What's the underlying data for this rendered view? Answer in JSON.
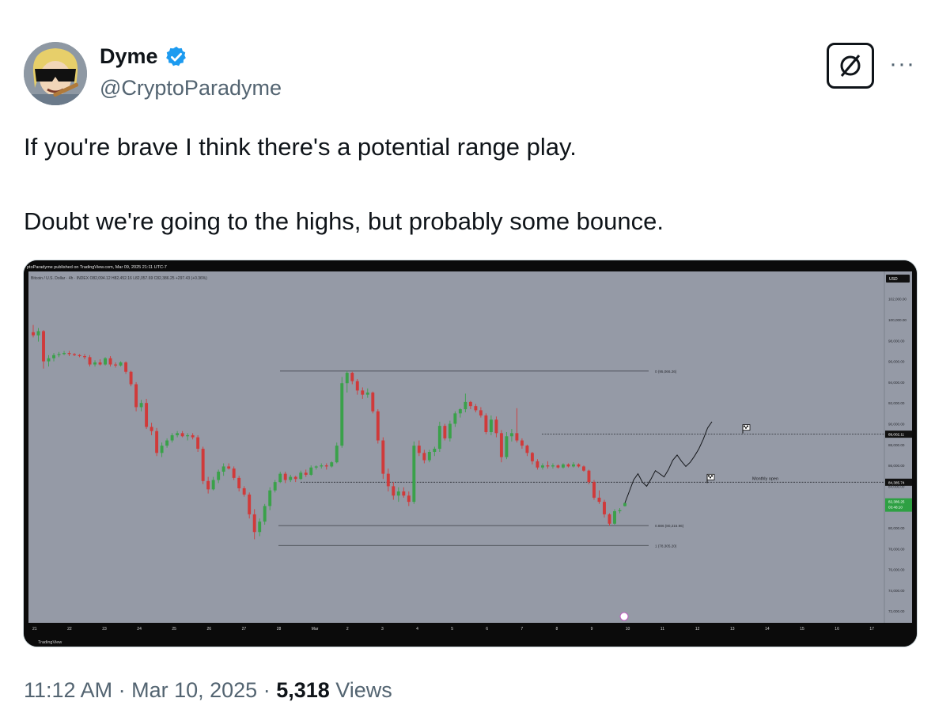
{
  "author": {
    "name": "Dyme",
    "handle": "@CryptoParadyme",
    "verified": true,
    "verified_color": "#1d9bf0"
  },
  "post": {
    "line1": "If you're brave I think there's a potential range play.",
    "line2": "Doubt we're going to the highs, but probably some bounce."
  },
  "actions": {
    "grok_icon": "grok-slash-icon",
    "more_label": "···"
  },
  "meta": {
    "time": "11:12 AM",
    "sep1": " · ",
    "date": "Mar 10, 2025",
    "sep2": " · ",
    "views_count": "5,318",
    "views_label": " Views"
  },
  "chart_data": {
    "type": "candlestick",
    "top_caption": "ptoParadyme published on TradingView.com, Mar 09, 2025 21:11 UTC-7",
    "symbol_line": "Bitcoin / U.S. Dollar · 4h · INDEX  O82,094.12  H82,452.16  L82,057.69  C82,386.25  +297.43 (+0.36%)",
    "watermark": "TradingView",
    "currency": "USD",
    "y_ticks": [
      "102,000.00",
      "100,000.00",
      "98,000.00",
      "96,000.00",
      "94,000.00",
      "92,000.00",
      "90,000.00",
      "88,000.00",
      "86,000.00",
      "84,000.00",
      "82,000.00",
      "80,000.00",
      "78,000.00",
      "76,000.00",
      "74,000.00",
      "72,000.00"
    ],
    "y_values": [
      102000,
      100000,
      98000,
      96000,
      94000,
      92000,
      90000,
      88000,
      86000,
      84000,
      82000,
      80000,
      78000,
      76000,
      74000,
      72000
    ],
    "x_ticks": [
      "21",
      "22",
      "23",
      "24",
      "25",
      "26",
      "27",
      "28",
      "Mar",
      "2",
      "3",
      "4",
      "5",
      "6",
      "7",
      "8",
      "9",
      "10",
      "11",
      "12",
      "13",
      "14",
      "15",
      "16",
      "17"
    ],
    "price_labels": {
      "upper": "89,002.11",
      "monthly": "84,385.74",
      "current": "82,386.25",
      "countdown": "03:48:10"
    },
    "fib_levels": [
      {
        "label": "0 (95,066.26)",
        "value": 95066.26
      },
      {
        "label": "0.886 (80,215.96)",
        "value": 80215.96
      },
      {
        "label": "1 (78,305.20)",
        "value": 78305.2
      }
    ],
    "annotation": "Monthly open",
    "levels": {
      "resistance": 89002.11,
      "monthly_open": 84385.74
    },
    "candles": [
      [
        98800,
        99500,
        98300,
        98500
      ],
      [
        98500,
        99200,
        97900,
        98900
      ],
      [
        98900,
        99000,
        95300,
        96000
      ],
      [
        96000,
        96600,
        95500,
        96300
      ],
      [
        96300,
        96800,
        96000,
        96600
      ],
      [
        96600,
        96900,
        96400,
        96700
      ],
      [
        96700,
        97000,
        96600,
        96800
      ],
      [
        96800,
        97000,
        96500,
        96700
      ],
      [
        96700,
        96800,
        96500,
        96600
      ],
      [
        96600,
        96700,
        96400,
        96500
      ],
      [
        96500,
        96700,
        96200,
        96400
      ],
      [
        96400,
        96600,
        95500,
        95700
      ],
      [
        95700,
        96100,
        95500,
        95900
      ],
      [
        95900,
        96200,
        95600,
        95700
      ],
      [
        95700,
        96400,
        95600,
        96300
      ],
      [
        96300,
        96500,
        95500,
        95700
      ],
      [
        95700,
        95900,
        95400,
        95600
      ],
      [
        95600,
        96000,
        95500,
        95900
      ],
      [
        95900,
        96000,
        94800,
        95000
      ],
      [
        95000,
        95100,
        93600,
        93800
      ],
      [
        93800,
        94000,
        91200,
        91600
      ],
      [
        91600,
        92300,
        91200,
        92000
      ],
      [
        92000,
        92400,
        89500,
        89700
      ],
      [
        89700,
        90100,
        88900,
        89300
      ],
      [
        89300,
        89600,
        86900,
        87200
      ],
      [
        87200,
        88200,
        86800,
        87900
      ],
      [
        87900,
        88600,
        87700,
        88400
      ],
      [
        88400,
        89100,
        88200,
        88900
      ],
      [
        88900,
        89300,
        88700,
        89100
      ],
      [
        89100,
        89300,
        88700,
        88800
      ],
      [
        88800,
        89100,
        88400,
        88900
      ],
      [
        88900,
        89100,
        88500,
        88700
      ],
      [
        88700,
        88900,
        87300,
        87600
      ],
      [
        87600,
        87800,
        84200,
        84500
      ],
      [
        84500,
        84900,
        83300,
        83700
      ],
      [
        83700,
        84900,
        83600,
        84600
      ],
      [
        84600,
        85600,
        84300,
        85400
      ],
      [
        85400,
        86200,
        85000,
        85900
      ],
      [
        85900,
        86200,
        85600,
        85700
      ],
      [
        85700,
        85900,
        84600,
        84800
      ],
      [
        84800,
        85000,
        83500,
        83800
      ],
      [
        83800,
        84000,
        83000,
        83200
      ],
      [
        83200,
        83400,
        80900,
        81300
      ],
      [
        81300,
        81800,
        78900,
        79600
      ],
      [
        79600,
        80900,
        79200,
        80600
      ],
      [
        80600,
        82300,
        80300,
        82100
      ],
      [
        82100,
        83900,
        81700,
        83600
      ],
      [
        83600,
        84600,
        83400,
        84400
      ],
      [
        84400,
        85400,
        84300,
        85200
      ],
      [
        85200,
        85400,
        84300,
        84600
      ],
      [
        84600,
        85100,
        84400,
        84900
      ],
      [
        84900,
        85000,
        84400,
        84700
      ],
      [
        84700,
        85500,
        84600,
        85300
      ],
      [
        85300,
        85600,
        84900,
        85100
      ],
      [
        85100,
        86000,
        85000,
        85800
      ],
      [
        85800,
        86000,
        85600,
        85900
      ],
      [
        85900,
        86200,
        85700,
        86000
      ],
      [
        86000,
        86200,
        85600,
        85900
      ],
      [
        85900,
        86400,
        85800,
        86300
      ],
      [
        86300,
        88200,
        86200,
        87900
      ],
      [
        87900,
        94500,
        87700,
        93900
      ],
      [
        93900,
        95066,
        93000,
        94900
      ],
      [
        94900,
        95000,
        93800,
        94100
      ],
      [
        94100,
        94300,
        92800,
        93200
      ],
      [
        93200,
        93500,
        92400,
        92800
      ],
      [
        92800,
        93400,
        92500,
        93000
      ],
      [
        93000,
        93100,
        91000,
        91200
      ],
      [
        91200,
        91400,
        88100,
        88400
      ],
      [
        88400,
        88700,
        84700,
        85200
      ],
      [
        85200,
        85700,
        83500,
        84000
      ],
      [
        84000,
        84400,
        82700,
        83100
      ],
      [
        83100,
        83900,
        82500,
        83500
      ],
      [
        83500,
        83900,
        82900,
        83100
      ],
      [
        83100,
        83500,
        82100,
        82500
      ],
      [
        82500,
        88300,
        82300,
        87900
      ],
      [
        87900,
        88400,
        86900,
        87200
      ],
      [
        87200,
        87500,
        86200,
        86500
      ],
      [
        86500,
        87500,
        86300,
        87300
      ],
      [
        87300,
        87800,
        86900,
        87600
      ],
      [
        87600,
        90200,
        87300,
        89800
      ],
      [
        89800,
        90000,
        88400,
        88600
      ],
      [
        88600,
        90300,
        88300,
        90000
      ],
      [
        90000,
        91200,
        89700,
        91000
      ],
      [
        91000,
        91500,
        90600,
        91400
      ],
      [
        91400,
        92900,
        91100,
        92100
      ],
      [
        92100,
        92200,
        91400,
        91700
      ],
      [
        91700,
        91900,
        91100,
        91300
      ],
      [
        91300,
        91600,
        90600,
        90800
      ],
      [
        90800,
        91000,
        89000,
        89200
      ],
      [
        89200,
        90800,
        88900,
        90400
      ],
      [
        90400,
        90700,
        88700,
        89100
      ],
      [
        89100,
        89400,
        86300,
        86800
      ],
      [
        86800,
        89200,
        86600,
        88800
      ],
      [
        88800,
        89500,
        88300,
        89100
      ],
      [
        89100,
        91500,
        88200,
        88400
      ],
      [
        88400,
        88600,
        87600,
        87900
      ],
      [
        87900,
        88000,
        86900,
        87200
      ],
      [
        87200,
        87300,
        86100,
        86400
      ],
      [
        86400,
        86600,
        85600,
        85800
      ],
      [
        85800,
        86200,
        85600,
        86000
      ],
      [
        86000,
        86400,
        85700,
        85900
      ],
      [
        85900,
        86200,
        85700,
        86000
      ],
      [
        86000,
        86100,
        85700,
        85800
      ],
      [
        85800,
        86200,
        85700,
        86100
      ],
      [
        86100,
        86200,
        85800,
        85900
      ],
      [
        85900,
        86300,
        85800,
        86100
      ],
      [
        86100,
        86200,
        85800,
        85900
      ],
      [
        85900,
        86000,
        85400,
        85500
      ],
      [
        85500,
        85600,
        84200,
        84400
      ],
      [
        84400,
        84600,
        82700,
        82900
      ],
      [
        82900,
        83600,
        82300,
        82500
      ],
      [
        82500,
        82700,
        81000,
        81300
      ],
      [
        81300,
        81400,
        80200,
        80400
      ],
      [
        80400,
        81800,
        80300,
        81600
      ],
      [
        81600,
        81900,
        81400,
        81700
      ],
      [
        82094,
        82452,
        82057,
        82386
      ]
    ],
    "projection": [
      [
        82386,
        0
      ],
      [
        83500,
        1
      ],
      [
        84600,
        2
      ],
      [
        85200,
        3
      ],
      [
        84400,
        4
      ],
      [
        84000,
        5
      ],
      [
        84700,
        6
      ],
      [
        85500,
        7
      ],
      [
        85200,
        8
      ],
      [
        84900,
        9
      ],
      [
        85600,
        10
      ],
      [
        86500,
        11
      ],
      [
        87000,
        12
      ],
      [
        86400,
        13
      ],
      [
        85900,
        14
      ],
      [
        86300,
        15
      ],
      [
        86900,
        16
      ],
      [
        87600,
        17
      ],
      [
        88500,
        18
      ],
      [
        89600,
        19
      ],
      [
        90200,
        20
      ]
    ]
  }
}
